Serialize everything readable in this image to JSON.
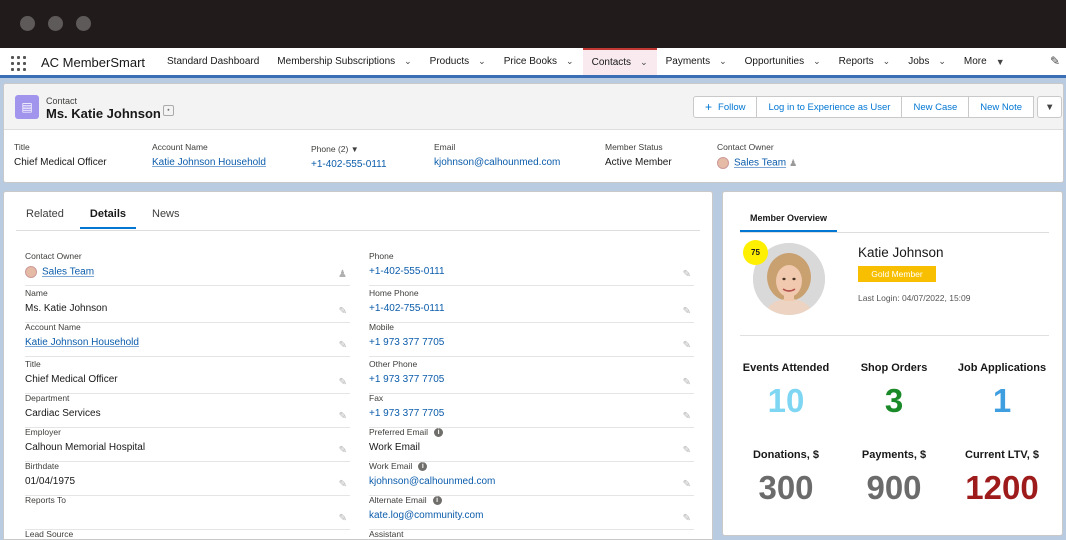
{
  "app": {
    "name": "AC MemberSmart"
  },
  "nav": {
    "items": [
      {
        "label": "Standard Dashboard",
        "chevron": false
      },
      {
        "label": "Membership Subscriptions",
        "chevron": true
      },
      {
        "label": "Products",
        "chevron": true
      },
      {
        "label": "Price Books",
        "chevron": true
      },
      {
        "label": "Contacts",
        "chevron": true,
        "active": true
      },
      {
        "label": "Payments",
        "chevron": true
      },
      {
        "label": "Opportunities",
        "chevron": true
      },
      {
        "label": "Reports",
        "chevron": true
      },
      {
        "label": "Jobs",
        "chevron": true
      },
      {
        "label": "More",
        "chevron": true
      }
    ]
  },
  "record": {
    "object_type": "Contact",
    "name": "Ms. Katie Johnson",
    "buttons": {
      "follow": "Follow",
      "login": "Log in to Experience as User",
      "new_case": "New Case",
      "new_note": "New Note"
    }
  },
  "highlights": [
    {
      "label": "Title",
      "value": "Chief Medical Officer"
    },
    {
      "label": "Account Name",
      "value": "Katie Johnson Household"
    },
    {
      "label": "Phone (2)",
      "value": "+1-402-555-0111"
    },
    {
      "label": "Email",
      "value": "kjohnson@calhounmed.com"
    },
    {
      "label": "Member Status",
      "value": "Active Member"
    },
    {
      "label": "Contact Owner",
      "value": "Sales Team"
    }
  ],
  "tabs": [
    "Related",
    "Details",
    "News"
  ],
  "details": {
    "left": [
      {
        "label": "Contact Owner",
        "value": "Sales Team"
      },
      {
        "label": "Name",
        "value": "Ms. Katie Johnson"
      },
      {
        "label": "Account Name",
        "value": "Katie Johnson Household"
      },
      {
        "label": "Title",
        "value": "Chief Medical Officer"
      },
      {
        "label": "Department",
        "value": "Cardiac Services"
      },
      {
        "label": "Employer",
        "value": "Calhoun Memorial Hospital"
      },
      {
        "label": "Birthdate",
        "value": "01/04/1975"
      },
      {
        "label": "Reports To",
        "value": ""
      },
      {
        "label": "Lead Source",
        "value": ""
      }
    ],
    "right": [
      {
        "label": "Phone",
        "value": "+1-402-555-0111"
      },
      {
        "label": "Home Phone",
        "value": "+1-402-755-0111"
      },
      {
        "label": "Mobile",
        "value": "+1 973 377 7705"
      },
      {
        "label": "Other Phone",
        "value": "+1 973 377 7705"
      },
      {
        "label": "Fax",
        "value": "+1 973 377 7705"
      },
      {
        "label": "Preferred Email",
        "value": "Work Email"
      },
      {
        "label": "Work Email",
        "value": "kjohnson@calhounmed.com"
      },
      {
        "label": "Alternate Email",
        "value": "kate.log@community.com"
      },
      {
        "label": "Assistant",
        "value": ""
      }
    ]
  },
  "overview": {
    "tab": "Member Overview",
    "score": "75",
    "name": "Katie Johnson",
    "tier": "Gold Member",
    "last_login": "Last Login: 04/07/2022, 15:09",
    "stats": [
      {
        "label": "Events Attended",
        "value": "10",
        "color": "#7fd6f3"
      },
      {
        "label": "Shop Orders",
        "value": "3",
        "color": "#1a8a28"
      },
      {
        "label": "Job Applications",
        "value": "1",
        "color": "#3f9ee0"
      },
      {
        "label": "Donations, $",
        "value": "300",
        "color": "#6b6b6b"
      },
      {
        "label": "Payments, $",
        "value": "900",
        "color": "#6b6b6b"
      },
      {
        "label": "Current LTV, $",
        "value": "1200",
        "color": "#9e1b1b"
      }
    ]
  }
}
